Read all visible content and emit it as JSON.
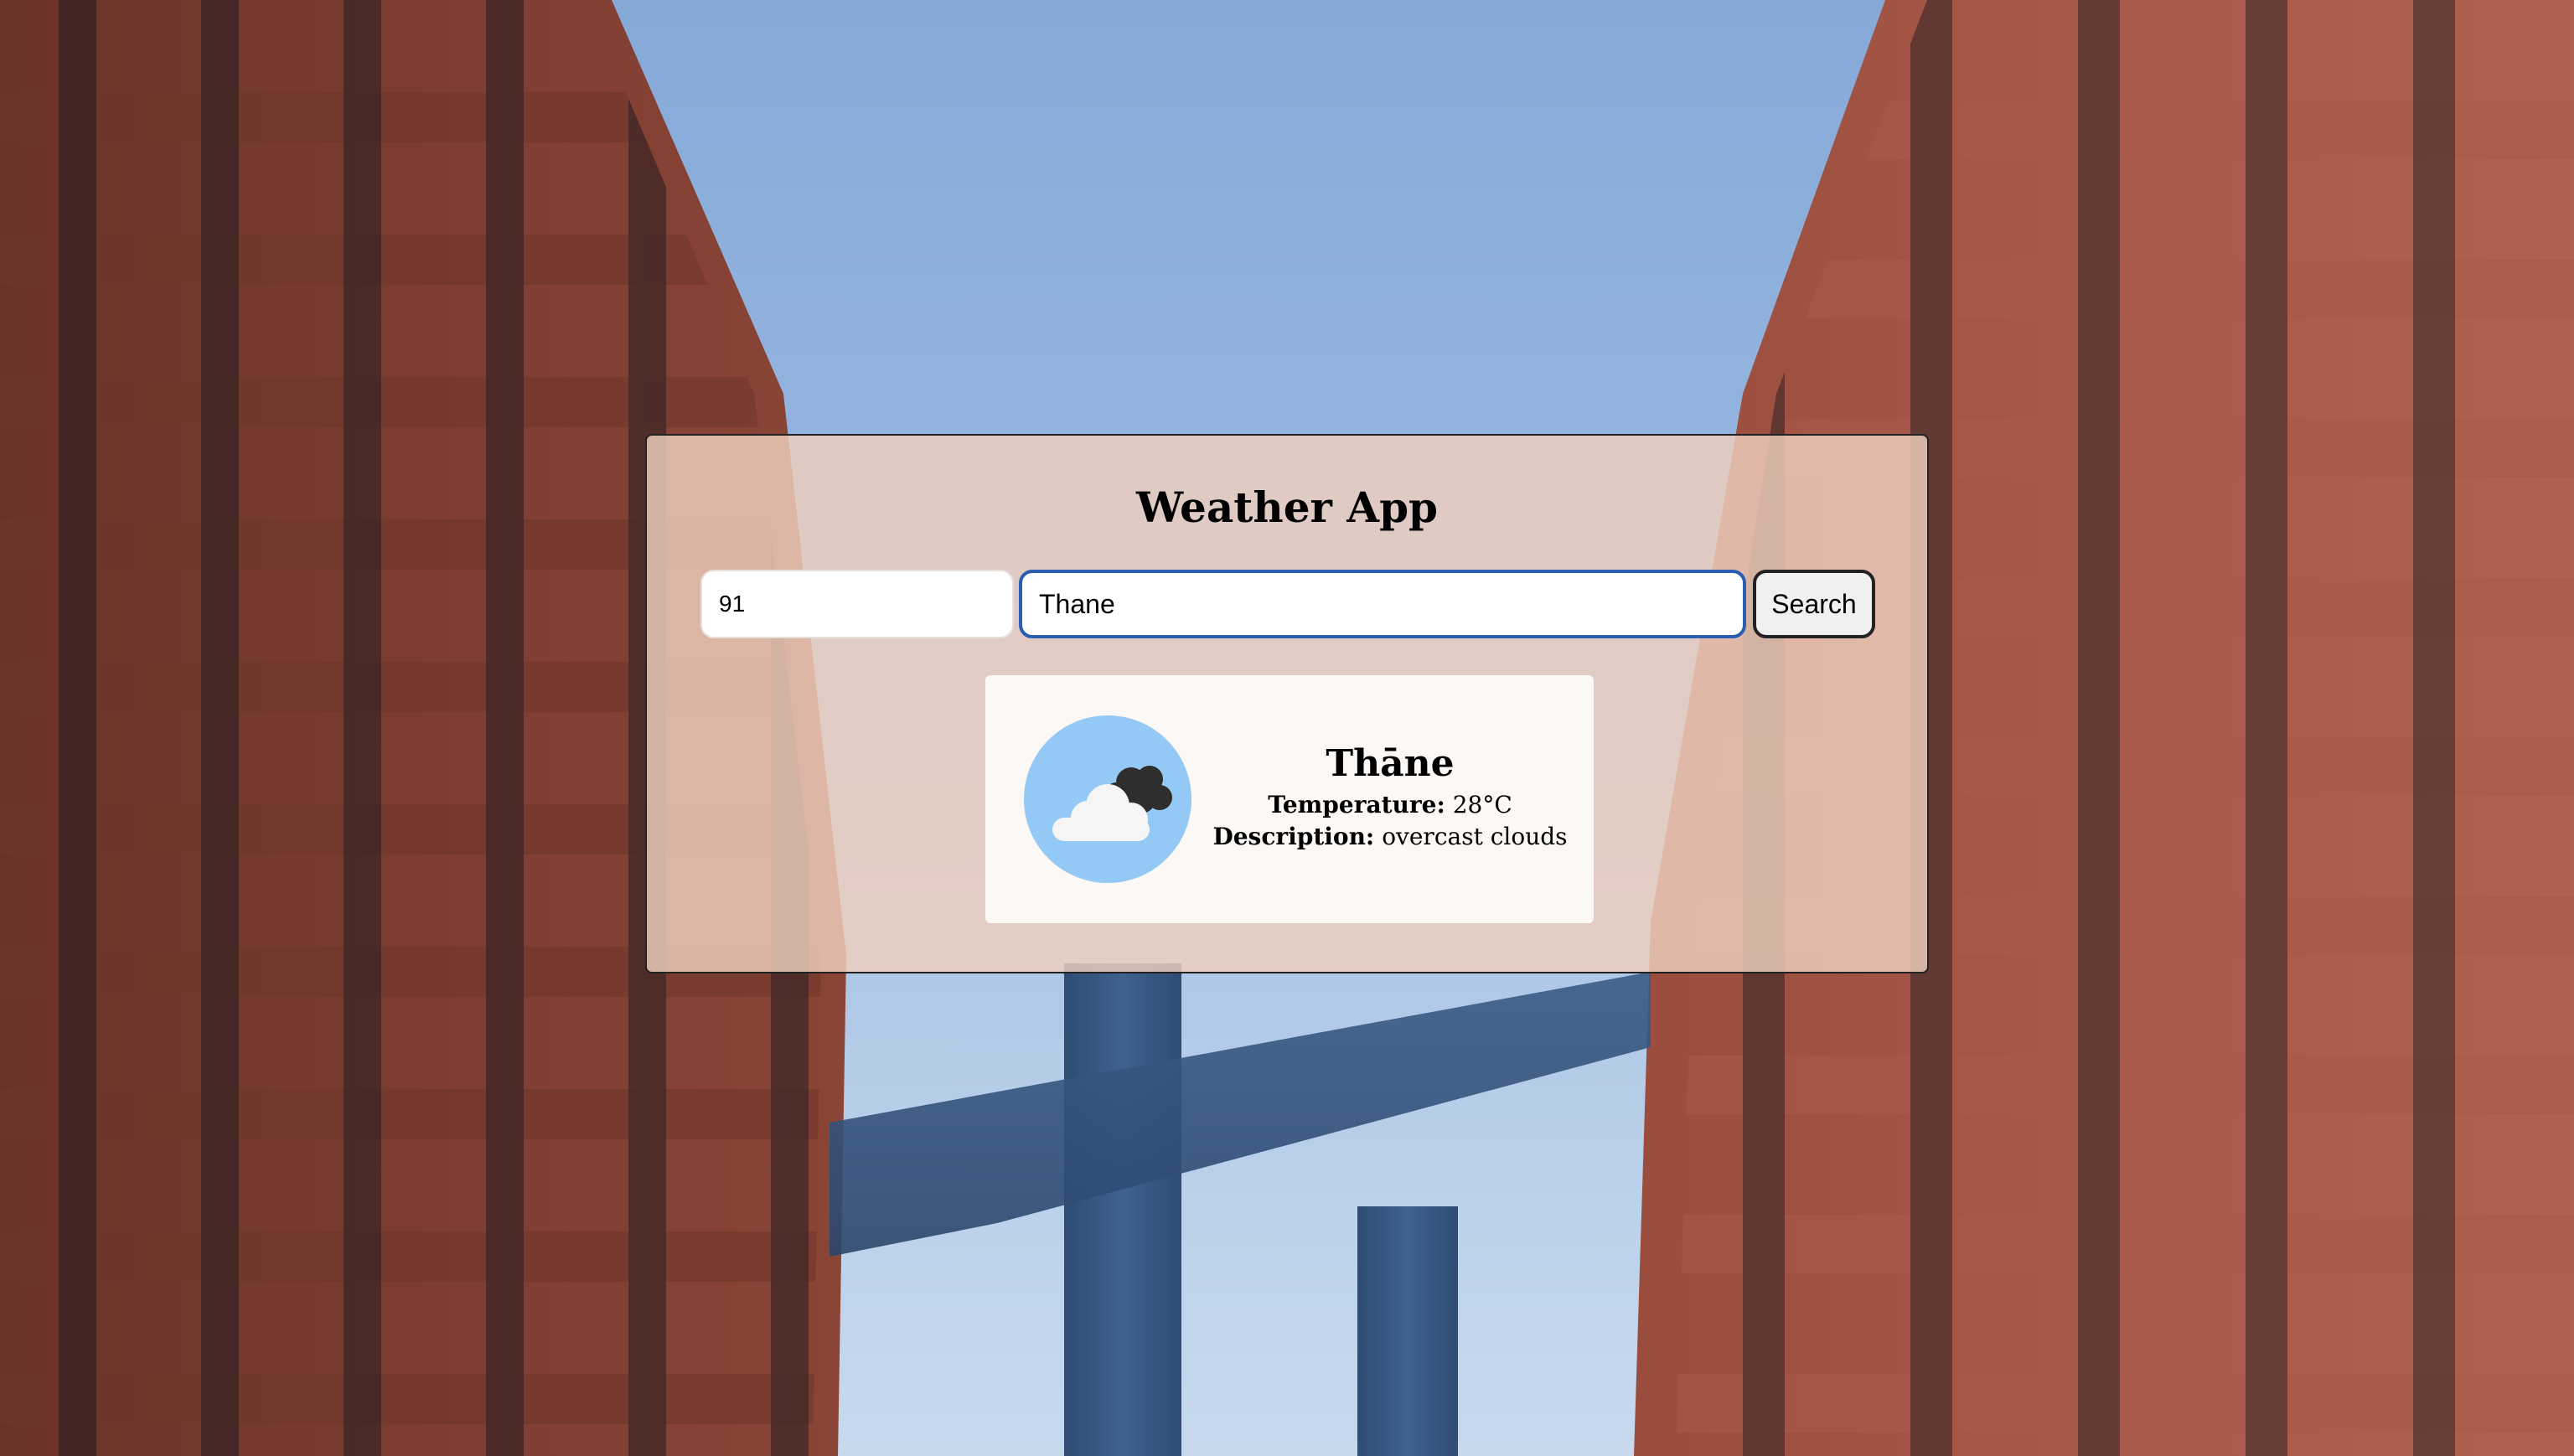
{
  "app": {
    "title": "Weather App"
  },
  "search": {
    "code_value": "91",
    "city_value": "Thane",
    "button_label": "Search"
  },
  "result": {
    "city": "Thāne",
    "temperature_label": "Temperature:",
    "temperature_value": "28°C",
    "description_label": "Description:",
    "description_value": "overcast clouds",
    "icon": "overcast-clouds-icon"
  },
  "colors": {
    "card_background": "#efd0be",
    "input_focus_border": "#2a5db0",
    "icon_circle": "#93c9f4"
  }
}
